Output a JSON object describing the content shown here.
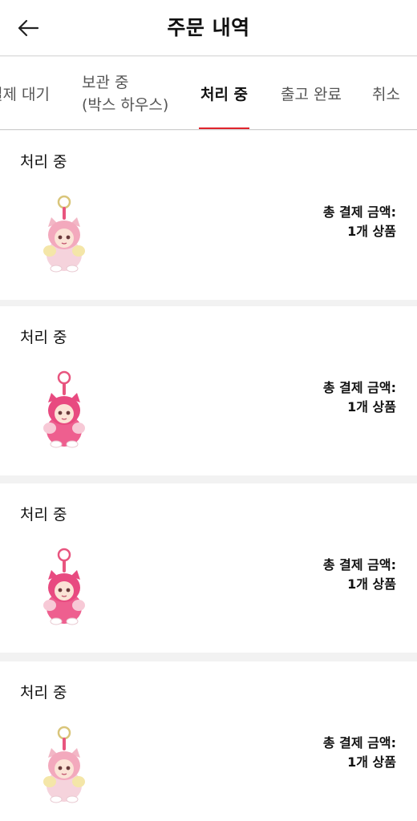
{
  "header": {
    "title": "주문 내역",
    "back_icon": "arrow-left-icon"
  },
  "tabs": [
    {
      "label": "결제 대기"
    },
    {
      "label_line1": "보관 중",
      "label_line2": "(박스 하우스)"
    },
    {
      "label": "처리 중",
      "active": true
    },
    {
      "label": "출고 완료"
    },
    {
      "label": "취소"
    }
  ],
  "accent_color": "#e0242c",
  "orders": [
    {
      "status": "처리 중",
      "total_label": "총 결제 금액:",
      "items_count": "1개 상품",
      "product_icon": "pink-plush-keychain-icon"
    },
    {
      "status": "처리 중",
      "total_label": "총 결제 금액:",
      "items_count": "1개 상품",
      "product_icon": "pink-plush-keychain-icon"
    },
    {
      "status": "처리 중",
      "total_label": "총 결제 금액:",
      "items_count": "1개 상품",
      "product_icon": "pink-plush-keychain-icon"
    },
    {
      "status": "처리 중",
      "total_label": "총 결제 금액:",
      "items_count": "1개 상품",
      "product_icon": "pink-plush-keychain-icon"
    }
  ]
}
